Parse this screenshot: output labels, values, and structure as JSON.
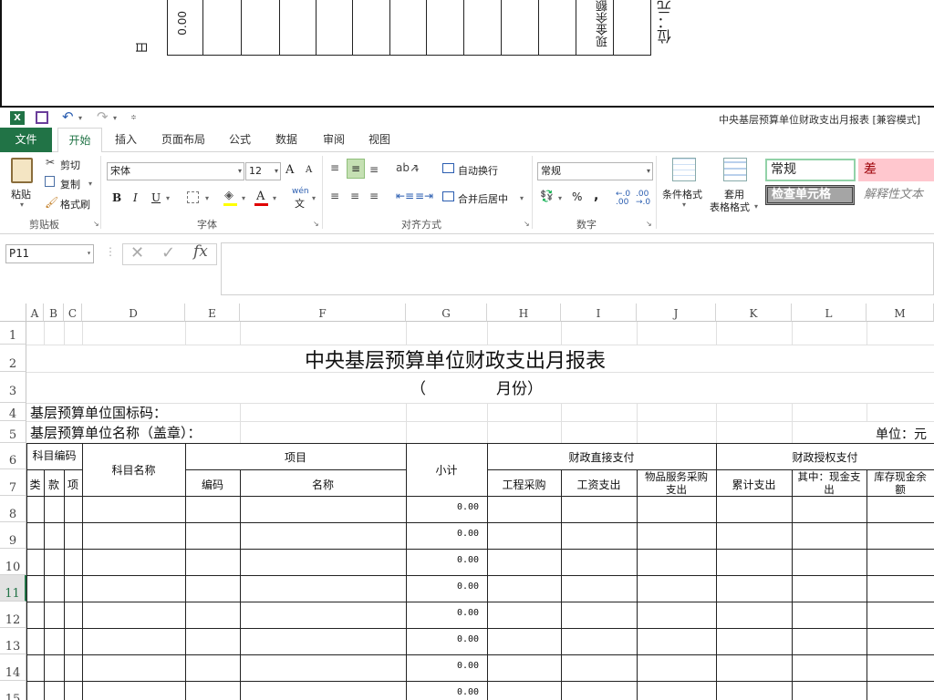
{
  "preview": {
    "value_rotated": "0.00",
    "col_text_rotated": "现金余额",
    "unit_rotated": "位：元",
    "side_glyph": "日"
  },
  "titlebar": {
    "title": "中央基层预算单位财政支出月报表  [兼容模式]",
    "qat_undo": "↶",
    "qat_redo": "↷"
  },
  "tabs": [
    "文件",
    "开始",
    "插入",
    "页面布局",
    "公式",
    "数据",
    "审阅",
    "视图"
  ],
  "ribbon": {
    "clipboard": {
      "paste": "粘贴",
      "cut": "剪切",
      "copy": "复制",
      "format_painter": "格式刷",
      "label": "剪贴板"
    },
    "font": {
      "name": "宋体",
      "size": "12",
      "bold": "B",
      "italic": "I",
      "underline": "U",
      "label": "字体",
      "grow": "A",
      "shrink": "A",
      "phonetic": "wén"
    },
    "alignment": {
      "wrap": "自动换行",
      "merge": "合并后居中",
      "label": "对齐方式"
    },
    "number": {
      "format": "常规",
      "percent": "%",
      "comma": ",",
      "inc_dec": "←.0 .00",
      "dec_dec": ".00 →.0",
      "label": "数字"
    },
    "styles": {
      "conditional": "条件格式",
      "table_format_1": "套用",
      "table_format_2": "表格格式",
      "normal": "常规",
      "bad": "差",
      "check_cell": "检查单元格",
      "explanatory": "解释性文本"
    }
  },
  "formula_bar": {
    "name_box": "P11",
    "cancel": "✕",
    "enter": "✓",
    "fx": "fx",
    "formula": ""
  },
  "columns": [
    "A",
    "B",
    "C",
    "D",
    "E",
    "F",
    "G",
    "H",
    "I",
    "J",
    "K",
    "L",
    "M"
  ],
  "rows": [
    "1",
    "2",
    "3",
    "4",
    "5",
    "6",
    "7",
    "8",
    "9",
    "10",
    "11",
    "12",
    "13",
    "14",
    "15"
  ],
  "sheet": {
    "title": "中央基层预算单位财政支出月报表",
    "month_open": "（",
    "month_label": "月份）",
    "code_label": "基层预算单位国标码：",
    "name_label": "基层预算单位名称（盖章）：",
    "unit": "单位：元",
    "headers": {
      "subject_code": "科目编码",
      "lei": "类",
      "kuan": "款",
      "xiang": "项",
      "subject_name": "科目名称",
      "project": "项目",
      "code": "编码",
      "name": "名称",
      "subtotal": "小计",
      "direct_pay": "财政直接支付",
      "engineering": "工程采购",
      "wages": "工资支出",
      "goods_1": "物品服务采购",
      "goods_2": "支出",
      "authorized_pay": "财政授权支付",
      "cumulative": "累计支出",
      "cash_1": "其中：现金支",
      "cash_2": "出",
      "stock_1": "库存现金余",
      "stock_2": "额"
    },
    "subtotals": [
      "0.00",
      "0.00",
      "0.00",
      "0.00",
      "0.00",
      "0.00",
      "0.00",
      "0.00"
    ]
  },
  "colors": {
    "excel_green": "#217346",
    "selected_row": "#217346",
    "bad_bg": "#ffc7ce",
    "bad_fg": "#9c0006",
    "normal_border": "#92d2a8"
  }
}
